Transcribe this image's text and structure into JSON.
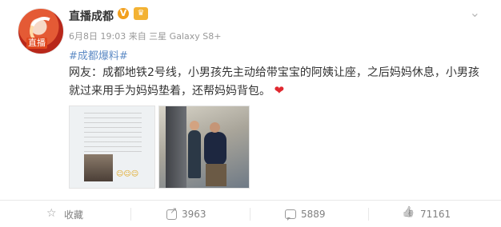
{
  "post": {
    "username": "直播成都",
    "vip_badge": "V",
    "rank_badge": "",
    "meta": "6月8日 19:03 来自 三星 Galaxy S8+",
    "topic": "#成都爆料#",
    "text": "网友：成都地铁2号线，小男孩先主动给带宝宝的阿姨让座，之后妈妈休息，小男孩就过来用手为妈妈垫着，还帮妈妈背包。",
    "avatar_label": "直播"
  },
  "actions": {
    "favorite_label": "收藏",
    "share_count": "3963",
    "comment_count": "5889",
    "like_count": "71161"
  },
  "colors": {
    "topic_link": "#5e8bc5",
    "heart": "#e0282f"
  },
  "icons": {
    "favorite": "star-icon",
    "share": "share-icon",
    "comment": "comment-icon",
    "like": "thumbs-up-icon",
    "heart": "heart-icon",
    "menu": "chevron-down-icon"
  }
}
